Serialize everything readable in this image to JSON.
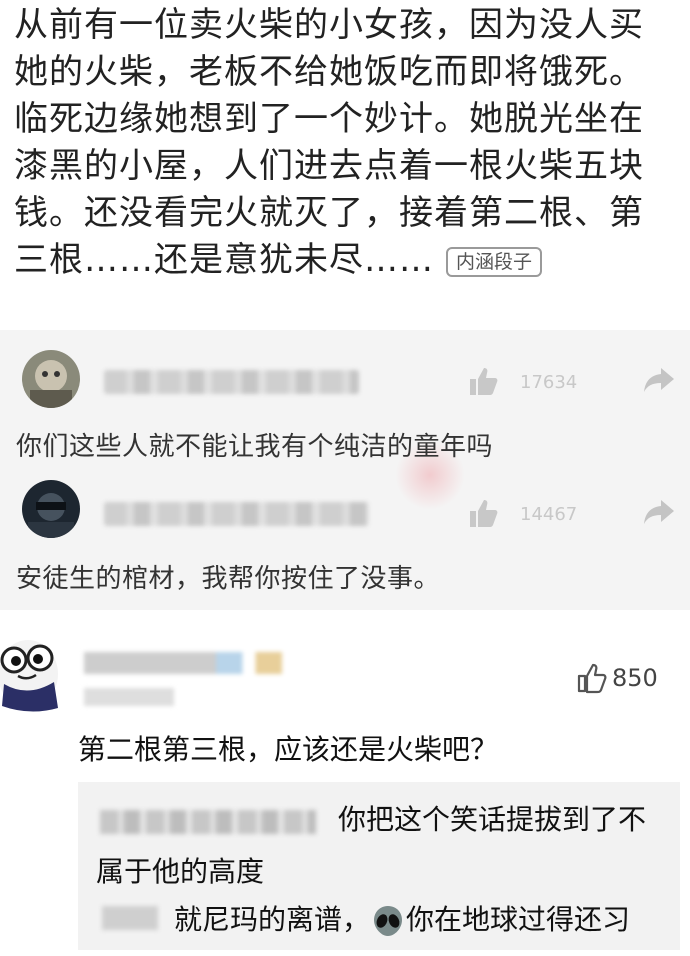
{
  "post": {
    "lines": [
      "从前有一位卖火柴的小女孩，因为没人买",
      "她的火柴，老板不给她饭吃而即将饿死。",
      "临死边缘她想到了一个妙计。她脱光坐在",
      "漆黑的小屋，人们进去点着一根火柴五块",
      "钱。还没看完火就灭了，接着第二根、第",
      "三根……还是意犹未尽……"
    ],
    "tag": "内涵段子"
  },
  "hot_comments": [
    {
      "likes": "17634",
      "text": "你们这些人就不能让我有个纯洁的童年吗"
    },
    {
      "likes": "14467",
      "text": "安徒生的棺材，我帮你按住了没事。"
    }
  ],
  "comment": {
    "likes": "850",
    "text": "第二根第三根，应该还是火柴吧？",
    "replies": [
      {
        "text_part1": "你把这个笑话提拔到了不",
        "text_part2": "属于他的高度"
      },
      {
        "text_before": "就尼玛的离谱，",
        "emoji": "alien-emoji",
        "text_after": "你在地球过得还习"
      }
    ]
  }
}
